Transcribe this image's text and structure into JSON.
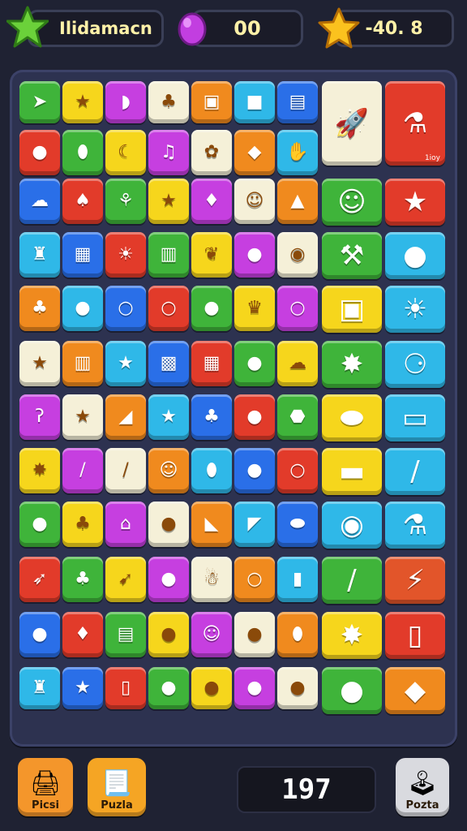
{
  "header": {
    "player_name": "Ilidamacn",
    "gems_value": "00",
    "stars_value": "-40. 8"
  },
  "board": {
    "small_tile_icons": [
      "arrow",
      "star",
      "candy",
      "leaf",
      "gift",
      "cube",
      "box",
      "lemon",
      "egg",
      "croissant",
      "bell",
      "flower",
      "diamond",
      "hand",
      "ghost",
      "acorn",
      "feather",
      "star",
      "pear",
      "robot",
      "cone",
      "bottle",
      "calc",
      "sun",
      "jar",
      "bean",
      "balloon",
      "orb",
      "leaf",
      "drop",
      "ring",
      "ring",
      "drop",
      "cupcake",
      "ring",
      "star",
      "jar",
      "star",
      "card",
      "tv",
      "drop",
      "ghost",
      "hook",
      "star",
      "flag",
      "star",
      "leaf",
      "dot",
      "nut",
      "splat",
      "pencil",
      "stick",
      "face",
      "egg",
      "dot",
      "ring",
      "lemon",
      "tree",
      "crown",
      "apple",
      "bullet",
      "horn",
      "oval",
      "cannon",
      "leaf",
      "boomerang",
      "orange",
      "gingerbread",
      "ring",
      "tooth",
      "lemon",
      "pin",
      "can",
      "dot",
      "face",
      "dot",
      "egg",
      "bottle",
      "star",
      "jug",
      "dot",
      "dot",
      "dot",
      "dot"
    ],
    "big_tile_icons": [
      "rocket",
      "potion",
      "frog",
      "star",
      "hammer",
      "drop",
      "bag",
      "sun",
      "germ",
      "bone",
      "slime",
      "eraser",
      "battery",
      "bat",
      "bomb",
      "rocket-pop",
      "leaf-stick",
      "flashlight",
      "virus",
      "tube",
      "berry",
      "gem"
    ],
    "potion_tag": "1ioy"
  },
  "footer": {
    "left_button_label": "Picsi",
    "middle_button_label": "Puzla",
    "right_button_label": "Pozta",
    "counter_value": "197"
  },
  "colors": {
    "background": "#1f2233",
    "board": "#2d3250",
    "accent_gold": "#f5b21c",
    "accent_orange": "#f4962b"
  }
}
